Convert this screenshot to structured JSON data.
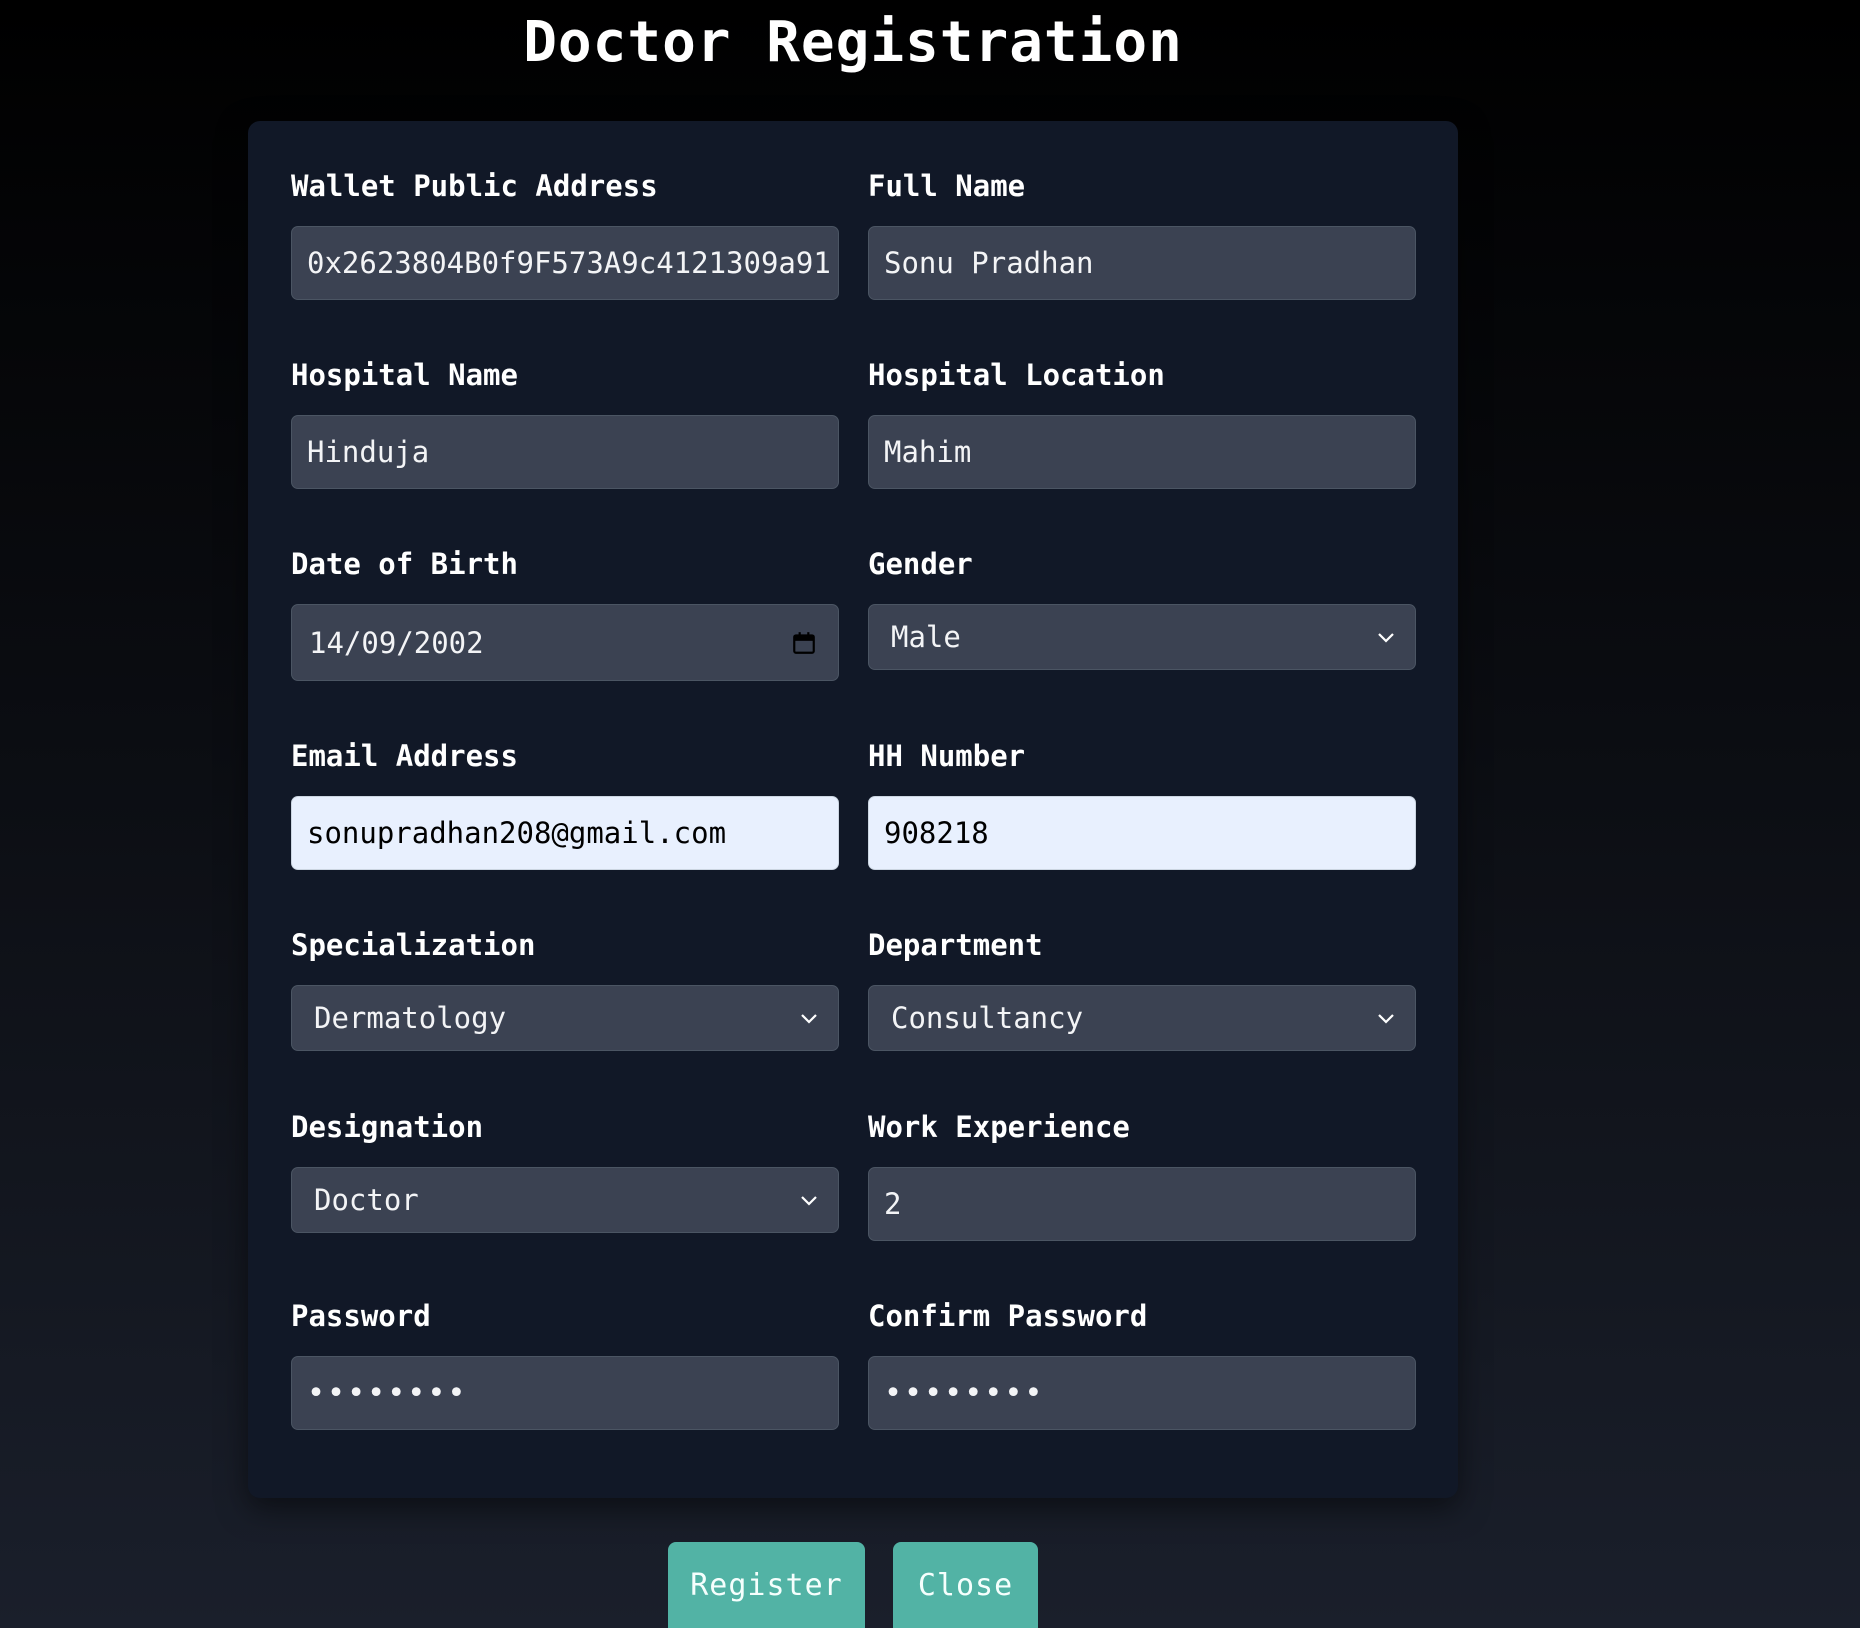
{
  "page": {
    "title": "Doctor Registration"
  },
  "form": {
    "wallet_address": {
      "label": "Wallet Public Address",
      "value": "0x2623804B0f9F573A9c4121309a91"
    },
    "full_name": {
      "label": "Full Name",
      "value": "Sonu Pradhan"
    },
    "hospital_name": {
      "label": "Hospital Name",
      "value": "Hinduja"
    },
    "hospital_location": {
      "label": "Hospital Location",
      "value": "Mahim"
    },
    "dob": {
      "label": "Date of Birth",
      "value": "14/09/2002"
    },
    "gender": {
      "label": "Gender",
      "value": "Male"
    },
    "email": {
      "label": "Email Address",
      "value": "sonupradhan208@gmail.com"
    },
    "hh_number": {
      "label": "HH Number",
      "value": "908218"
    },
    "specialization": {
      "label": "Specialization",
      "value": "Dermatology"
    },
    "department": {
      "label": "Department",
      "value": "Consultancy"
    },
    "designation": {
      "label": "Designation",
      "value": "Doctor"
    },
    "work_experience": {
      "label": "Work Experience",
      "value": "2"
    },
    "password": {
      "label": "Password",
      "value": "••••••••"
    },
    "confirm_password": {
      "label": "Confirm Password",
      "value": "••••••••"
    }
  },
  "buttons": {
    "register": "Register",
    "close": "Close"
  },
  "colors": {
    "card_bg": "#111827",
    "input_bg": "#3b4252",
    "autofill_bg": "#e8f0fe",
    "button_bg": "#52b3a5"
  },
  "icons": {
    "date": "calendar-icon",
    "select": "chevron-down-icon"
  }
}
